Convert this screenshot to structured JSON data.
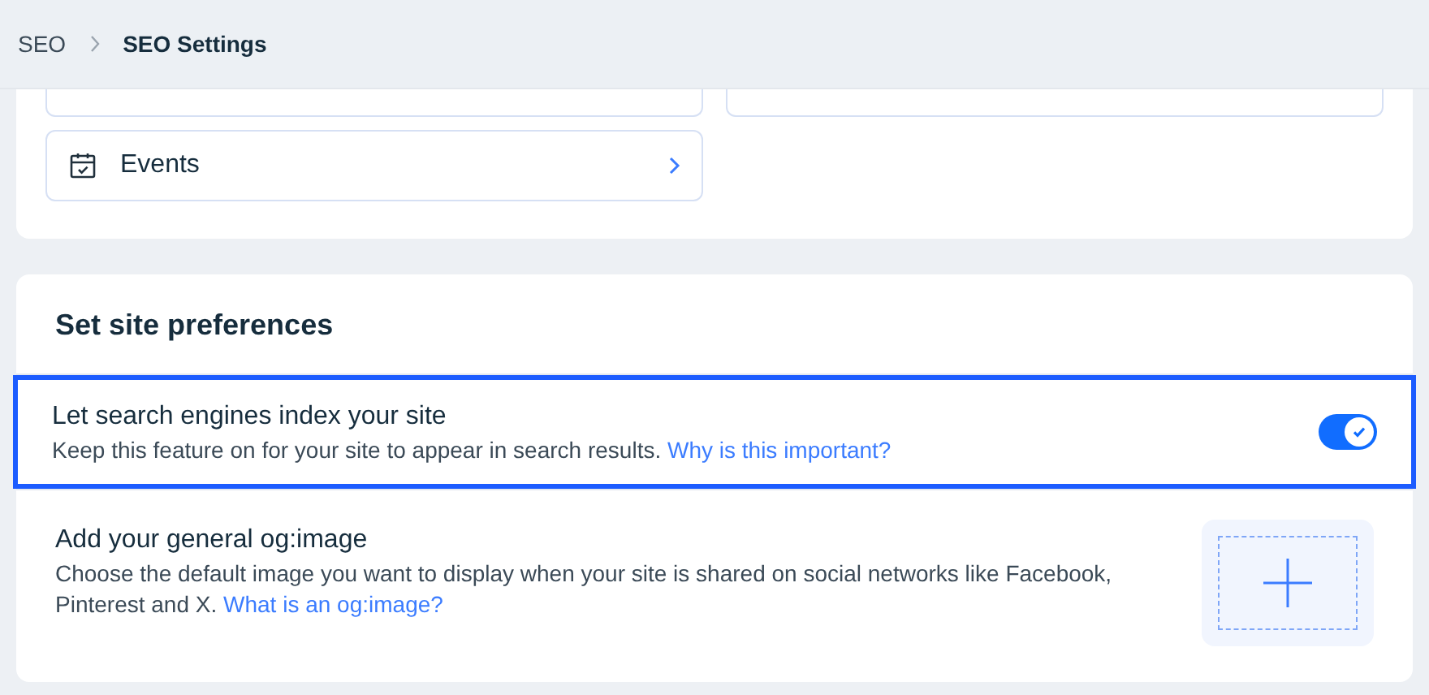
{
  "breadcrumb": [
    {
      "label": "SEO",
      "current": false
    },
    {
      "label": "SEO Settings",
      "current": true
    }
  ],
  "page_links": [
    {
      "kind": "cut"
    },
    {
      "kind": "cut"
    },
    {
      "label": "Events",
      "kind": "calendar"
    }
  ],
  "preferences": {
    "title": "Set site preferences",
    "settings": [
      {
        "kind": "toggle",
        "title": "Let search engines index your site",
        "description": "Keep this feature on for your site to appear in search results.",
        "link": "Why is this important?",
        "on": true,
        "highlighted": true
      },
      {
        "kind": "image_upload",
        "title": "Add your general og:image",
        "description": "Choose the default image you want to display when your site is shared on social networks like Facebook, Pinterest and X.",
        "link": "What is an og:image?",
        "highlighted": false
      }
    ]
  }
}
